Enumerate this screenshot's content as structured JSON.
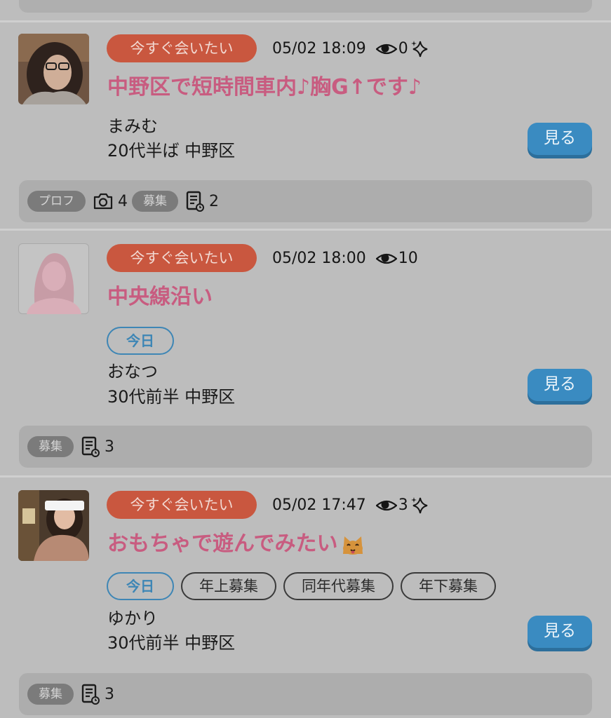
{
  "posts": [
    {
      "badge": "今すぐ会いたい",
      "datetime": "05/02 18:09",
      "views": "0",
      "has_sparkle": true,
      "title": "中野区で短時間車内♪胸G↑です♪",
      "name": "まみむ",
      "info": "20代半ば 中野区",
      "view_label": "見る",
      "stats": {
        "profile_label": "プロフ",
        "photo_count": "4",
        "recruit_label": "募集",
        "post_count": "2"
      }
    },
    {
      "badge": "今すぐ会いたい",
      "datetime": "05/02 18:00",
      "views": "10",
      "has_sparkle": false,
      "title": "中央線沿い",
      "tags": [
        "今日"
      ],
      "name": "おなつ",
      "info": "30代前半 中野区",
      "view_label": "見る",
      "stats": {
        "recruit_label": "募集",
        "post_count": "3"
      }
    },
    {
      "badge": "今すぐ会いたい",
      "datetime": "05/02 17:47",
      "views": "3",
      "has_sparkle": true,
      "title": "おもちゃで遊んでみたい",
      "title_emoji": "cat-face-icon",
      "tags": [
        "今日",
        "年上募集",
        "同年代募集",
        "年下募集"
      ],
      "name": "ゆかり",
      "info": "30代前半 中野区",
      "view_label": "見る",
      "stats": {
        "recruit_label": "募集",
        "post_count": "3"
      }
    }
  ],
  "colors": {
    "background": "#bdbdbd",
    "badge_now": "#c9573f",
    "title_pink": "#c85c80",
    "today_blue": "#3e86b5",
    "view_button": "#3a8bc1",
    "stats_bar": "#adadad"
  }
}
